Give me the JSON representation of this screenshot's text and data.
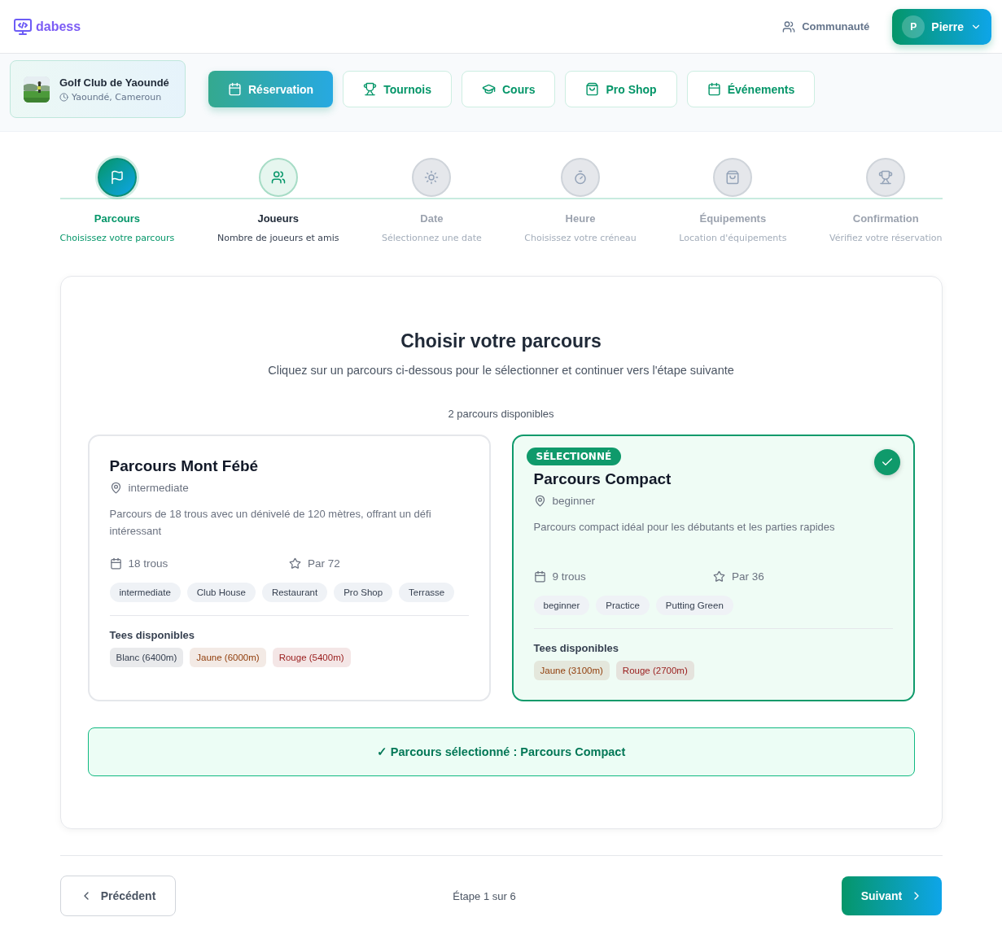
{
  "header": {
    "logo": "dabess",
    "community": "Communauté",
    "user": {
      "initial": "P",
      "name": "Pierre"
    }
  },
  "club": {
    "name": "Golf Club de Yaoundé",
    "location": "Yaoundé, Cameroun"
  },
  "nav": [
    {
      "label": "Réservation",
      "selected": true
    },
    {
      "label": "Tournois",
      "selected": false
    },
    {
      "label": "Cours",
      "selected": false
    },
    {
      "label": "Pro Shop",
      "selected": false
    },
    {
      "label": "Événements",
      "selected": false
    }
  ],
  "steps": [
    {
      "title": "Parcours",
      "subtitle": "Choisissez votre parcours",
      "selected": true,
      "disabled": false
    },
    {
      "title": "Joueurs",
      "subtitle": "Nombre de joueurs et amis",
      "selected": false,
      "disabled": false
    },
    {
      "title": "Date",
      "subtitle": "Sélectionnez une date",
      "selected": false,
      "disabled": true
    },
    {
      "title": "Heure",
      "subtitle": "Choisissez votre créneau",
      "selected": false,
      "disabled": true
    },
    {
      "title": "Équipements",
      "subtitle": "Location d'équipements",
      "selected": false,
      "disabled": true
    },
    {
      "title": "Confirmation",
      "subtitle": "Vérifiez votre réservation",
      "selected": false,
      "disabled": true
    }
  ],
  "panel": {
    "title": "Choisir votre parcours",
    "subtitle": "Cliquez sur un parcours ci-dessous pour le sélectionner et continuer vers l'étape suivante",
    "count": "2 parcours disponibles"
  },
  "courses": [
    {
      "name": "Parcours Mont Fébé",
      "level": "intermediate",
      "description": "Parcours de 18 trous avec un dénivelé de 120 mètres, offrant un défi intéressant",
      "holes": "18 trous",
      "par": "Par 72",
      "tags": [
        "intermediate",
        "Club House",
        "Restaurant",
        "Pro Shop",
        "Terrasse"
      ],
      "tees_label": "Tees disponibles",
      "tees": [
        {
          "label": "Blanc (6400m)",
          "color": "#374151"
        },
        {
          "label": "Jaune (6000m)",
          "color": "#92400e"
        },
        {
          "label": "Rouge (5400m)",
          "color": "#991b1b"
        }
      ],
      "selected": false
    },
    {
      "name": "Parcours Compact",
      "level": "beginner",
      "description": "Parcours compact idéal pour les débutants et les parties rapides",
      "holes": "9 trous",
      "par": "Par 36",
      "tags": [
        "beginner",
        "Practice",
        "Putting Green"
      ],
      "tees_label": "Tees disponibles",
      "tees": [
        {
          "label": "Jaune (3100m)",
          "color": "#92400e"
        },
        {
          "label": "Rouge (2700m)",
          "color": "#991b1b"
        }
      ],
      "selected": true,
      "badge": "SÉLECTIONNÉ"
    }
  ],
  "confirmation": "✓ Parcours sélectionné : Parcours Compact",
  "footer": {
    "previous": "Précédent",
    "step": "Étape 1 sur 6",
    "next": "Suivant"
  }
}
